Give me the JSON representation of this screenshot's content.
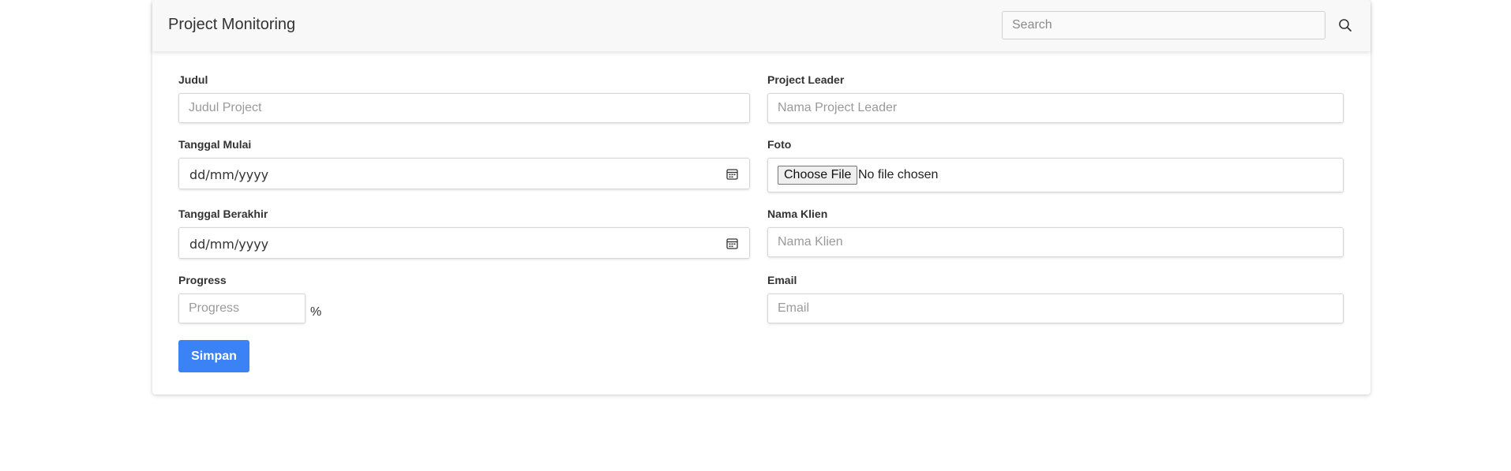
{
  "header": {
    "title": "Project Monitoring",
    "search_placeholder": "Search"
  },
  "form": {
    "judul": {
      "label": "Judul",
      "placeholder": "Judul Project"
    },
    "project_leader": {
      "label": "Project Leader",
      "placeholder": "Nama Project Leader"
    },
    "tanggal_mulai": {
      "label": "Tanggal Mulai",
      "value": "dd/mm/yyyy"
    },
    "foto": {
      "label": "Foto",
      "button": "Choose File",
      "status": "No file chosen"
    },
    "tanggal_berakhir": {
      "label": "Tanggal Berakhir",
      "value": "dd/mm/yyyy"
    },
    "nama_klien": {
      "label": "Nama Klien",
      "placeholder": "Nama Klien"
    },
    "progress": {
      "label": "Progress",
      "placeholder": "Progress",
      "unit": "%"
    },
    "email": {
      "label": "Email",
      "placeholder": "Email"
    },
    "submit_label": "Simpan"
  },
  "colors": {
    "primary": "#3b82f6",
    "header_bg": "#f8f8f8",
    "text": "#333333"
  },
  "icons": {
    "search": "search-icon",
    "calendar": "calendar-icon"
  }
}
